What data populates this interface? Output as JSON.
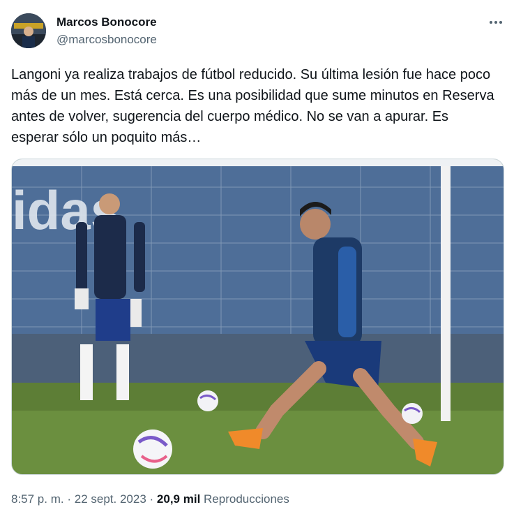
{
  "author": {
    "name": "Marcos Bonocore",
    "handle": "@marcosbonocore"
  },
  "tweet": {
    "text": "Langoni ya realiza trabajos de fútbol reducido. Su última lesión fue hace poco más de un mes. Está cerca. Es una posibilidad que sume minutos en Reserva antes de volver, sugerencia del cuerpo médico. No se van a apurar. Es esperar sólo un poquito más…"
  },
  "media": {
    "banner_text": "idas"
  },
  "meta": {
    "time": "8:57 p. m.",
    "separator": "·",
    "date": "22 sept. 2023",
    "views_count": "20,9 mil",
    "views_label": "Reproducciones"
  },
  "icons": {
    "more": "more-horizontal-icon"
  },
  "colors": {
    "text": "#0f1419",
    "secondary": "#536471",
    "border": "#cfd9de"
  }
}
